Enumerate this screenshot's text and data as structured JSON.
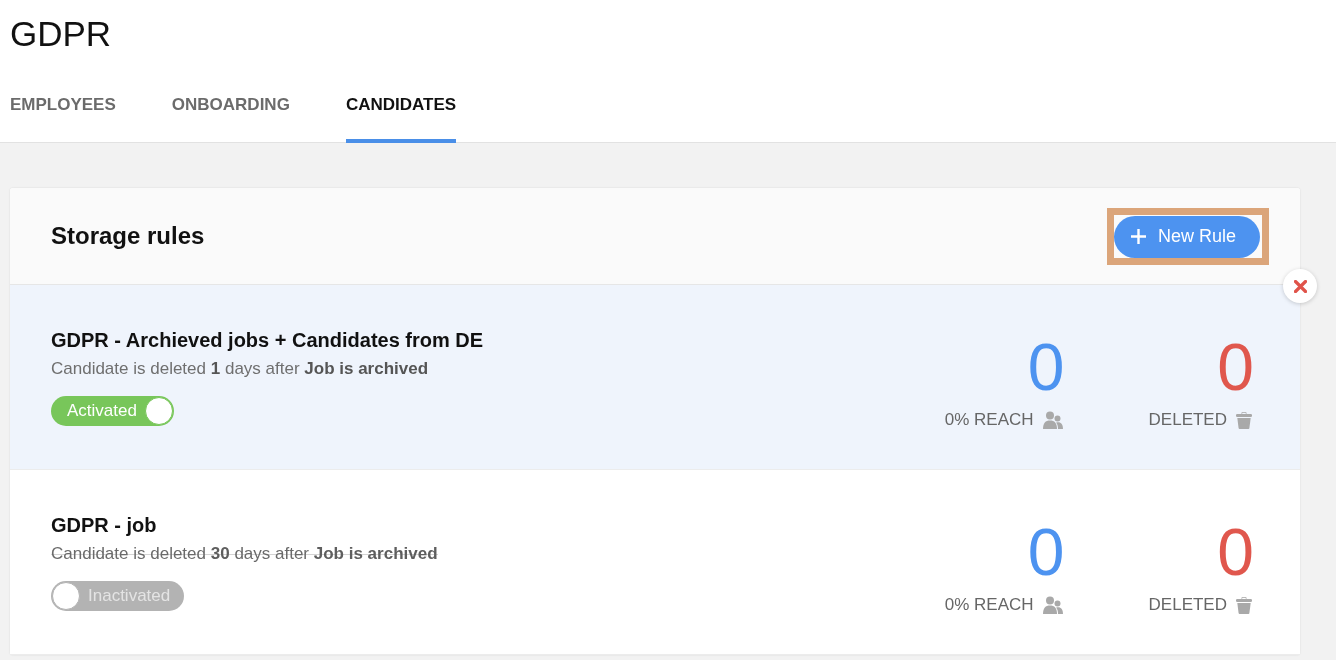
{
  "page": {
    "title": "GDPR"
  },
  "tabs": [
    {
      "label": "EMPLOYEES",
      "selected": false
    },
    {
      "label": "ONBOARDING",
      "selected": false
    },
    {
      "label": "CANDIDATES",
      "selected": true
    }
  ],
  "panel": {
    "title": "Storage rules",
    "new_rule_button": {
      "label": "New Rule",
      "highlighted": true
    }
  },
  "rules": [
    {
      "title": "GDPR - Archieved jobs + Candidates from DE",
      "description": "Candidate is deleted **1** days after **Job is archived**",
      "active": true,
      "toggle_label": "Activated",
      "highlighted": true,
      "stats": [
        {
          "kind": "reach",
          "value": "0",
          "label": "0% REACH"
        },
        {
          "kind": "deleted",
          "value": "0",
          "label": "DELETED"
        }
      ]
    },
    {
      "title": "GDPR - job",
      "description": "Candidate is deleted **30** days after **Job is archived**",
      "active": false,
      "toggle_label": "Inactivated",
      "highlighted": false,
      "stats": [
        {
          "kind": "reach",
          "value": "0",
          "label": "0% REACH"
        },
        {
          "kind": "deleted",
          "value": "0",
          "label": "DELETED"
        }
      ]
    }
  ]
}
